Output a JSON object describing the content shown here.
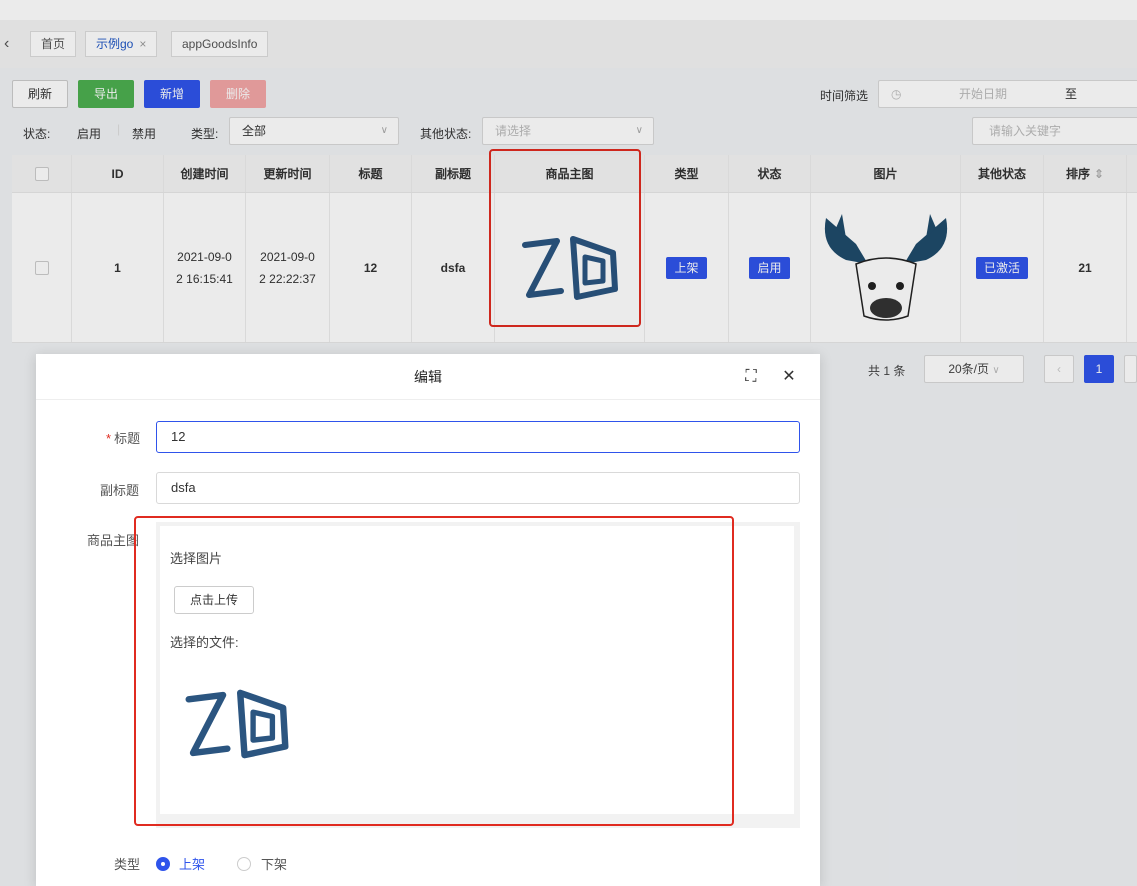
{
  "tabs": {
    "back_icon": "chevron-left-icon",
    "items": [
      {
        "label": "首页"
      },
      {
        "label": "示例go",
        "close": "×"
      },
      {
        "label": "appGoodsInfo"
      }
    ]
  },
  "toolbar": {
    "refresh": "刷新",
    "export": "导出",
    "add": "新增",
    "delete": "删除",
    "time_filter_label": "时间筛选",
    "start_date_placeholder": "开始日期",
    "date_sep": "至"
  },
  "filters": {
    "status_label": "状态:",
    "status_enabled": "启用",
    "status_disabled": "禁用",
    "type_label": "类型:",
    "type_value": "全部",
    "other_status_label": "其他状态:",
    "other_status_placeholder": "请选择",
    "keyword_placeholder": "请输入关键字"
  },
  "table": {
    "columns": [
      "ID",
      "创建时间",
      "更新时间",
      "标题",
      "副标题",
      "商品主图",
      "类型",
      "状态",
      "图片",
      "其他状态",
      "排序"
    ],
    "row": {
      "id": "1",
      "created_line1": "2021-09-0",
      "created_line2": "2 16:15:41",
      "updated_line1": "2021-09-0",
      "updated_line2": "2 22:22:37",
      "title": "12",
      "subtitle": "dsfa",
      "type_tag": "上架",
      "status_tag": "启用",
      "other_status_tag": "已激活",
      "sort": "21"
    }
  },
  "pagination": {
    "total": "共 1 条",
    "page_size": "20条/页",
    "current_page": "1"
  },
  "modal": {
    "title": "编辑",
    "title_label": "标题",
    "title_value": "12",
    "subtitle_label": "副标题",
    "subtitle_value": "dsfa",
    "image_label": "商品主图",
    "choose_image": "选择图片",
    "upload_button": "点击上传",
    "chosen_files": "选择的文件:",
    "type_label": "类型",
    "type_on": "上架",
    "type_off": "下架"
  },
  "colors": {
    "accent": "#2f54eb",
    "export_green": "#4caf50",
    "delete_disabled": "#f4a7a7",
    "highlight_red": "#e02b20",
    "logo_blue": "#2b5580"
  }
}
